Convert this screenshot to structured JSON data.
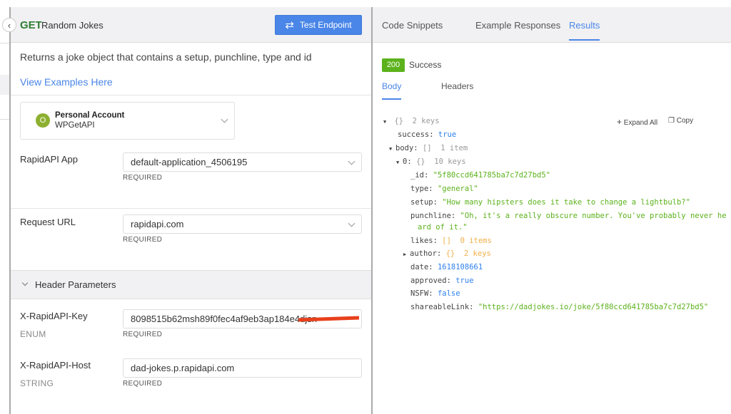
{
  "endpoint": {
    "method": "GET",
    "name": "Random Jokes",
    "test_button": "Test Endpoint",
    "description": "Returns a joke object that contains a setup, punchline, type and id",
    "examples_link": "View Examples Here"
  },
  "account": {
    "avatar_letter": "O",
    "title": "Personal Account",
    "name": "WPGetAPI"
  },
  "params": {
    "app": {
      "label": "RapidAPI App",
      "value": "default-application_4506195",
      "required": "REQUIRED"
    },
    "url": {
      "label": "Request URL",
      "value": "rapidapi.com",
      "required": "REQUIRED"
    },
    "header_section": "Header Parameters",
    "key": {
      "label": "X-RapidAPI-Key",
      "type": "ENUM",
      "value": "8098515b62msh89f0fec4af9eb3ap184e4djsn",
      "required": "REQUIRED"
    },
    "host": {
      "label": "X-RapidAPI-Host",
      "type": "STRING",
      "value": "dad-jokes.p.rapidapi.com",
      "required": "REQUIRED"
    }
  },
  "right": {
    "tabs": [
      "Code Snippets",
      "Example Responses",
      "Results"
    ],
    "status_code": "200",
    "status_text": "Success",
    "subtabs": [
      "Body",
      "Headers"
    ],
    "expand_all": "Expand All",
    "copy": "Copy"
  },
  "tree": {
    "root": {
      "brace": "{}",
      "count": "2 keys"
    },
    "success": {
      "key": "success:",
      "val": "true"
    },
    "body": {
      "key": "body:",
      "brace": "[]",
      "count": "1 item"
    },
    "item0": {
      "key": "0:",
      "brace": "{}",
      "count": "10 keys"
    },
    "id": {
      "key": "_id:",
      "val": "\"5f80ccd641785ba7c7d27bd5\""
    },
    "type": {
      "key": "type:",
      "val": "\"general\""
    },
    "setup": {
      "key": "setup:",
      "val": "\"How many hipsters does it take to change a lightbulb?\""
    },
    "punchline": {
      "key": "punchline:",
      "val1": "\"Oh, it's a really obscure number. You've probably never he",
      "val2": "ard of it.\""
    },
    "likes": {
      "key": "likes:",
      "brace": "[]",
      "count": "0 items"
    },
    "author": {
      "key": "author:",
      "brace": "{}",
      "count": "2 keys"
    },
    "date": {
      "key": "date:",
      "val": "1618108661"
    },
    "approved": {
      "key": "approved:",
      "val": "true"
    },
    "nsfw": {
      "key": "NSFW:",
      "val": "false"
    },
    "link": {
      "key": "shareableLink:",
      "val": "\"https://dadjokes.io/joke/5f80ccd641785ba7c7d27bd5\""
    }
  },
  "colors": {
    "accent": "#4a86e8",
    "success": "#5cb21c",
    "get": "#2e7d32"
  }
}
